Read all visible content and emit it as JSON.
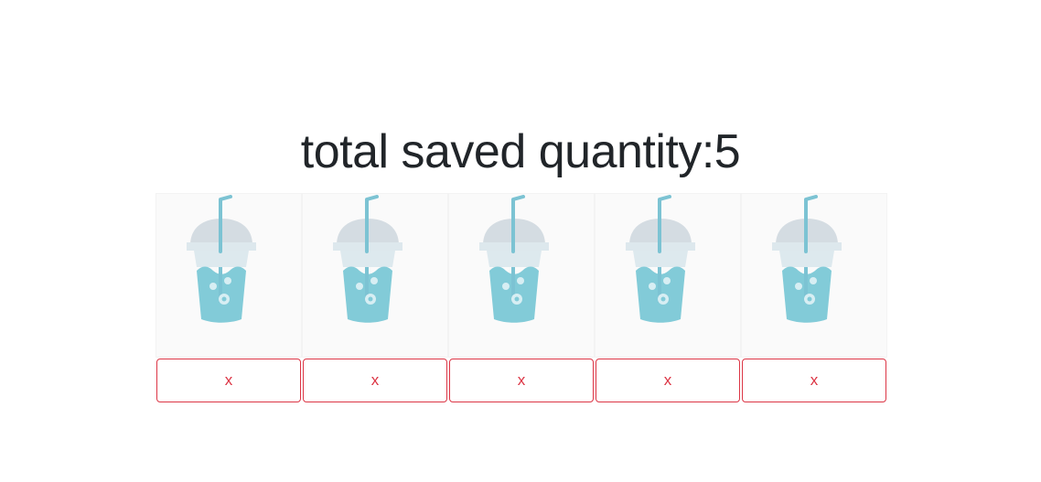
{
  "header": {
    "title_prefix": "total saved quantity:",
    "quantity": "5"
  },
  "items": [
    {
      "icon": "drink-cup-icon",
      "remove_label": "x"
    },
    {
      "icon": "drink-cup-icon",
      "remove_label": "x"
    },
    {
      "icon": "drink-cup-icon",
      "remove_label": "x"
    },
    {
      "icon": "drink-cup-icon",
      "remove_label": "x"
    },
    {
      "icon": "drink-cup-icon",
      "remove_label": "x"
    }
  ],
  "colors": {
    "drink": "#82cbd8",
    "lid": "#d6dde3",
    "straw": "#7cc3d3",
    "remove_button": "#dc3545"
  }
}
